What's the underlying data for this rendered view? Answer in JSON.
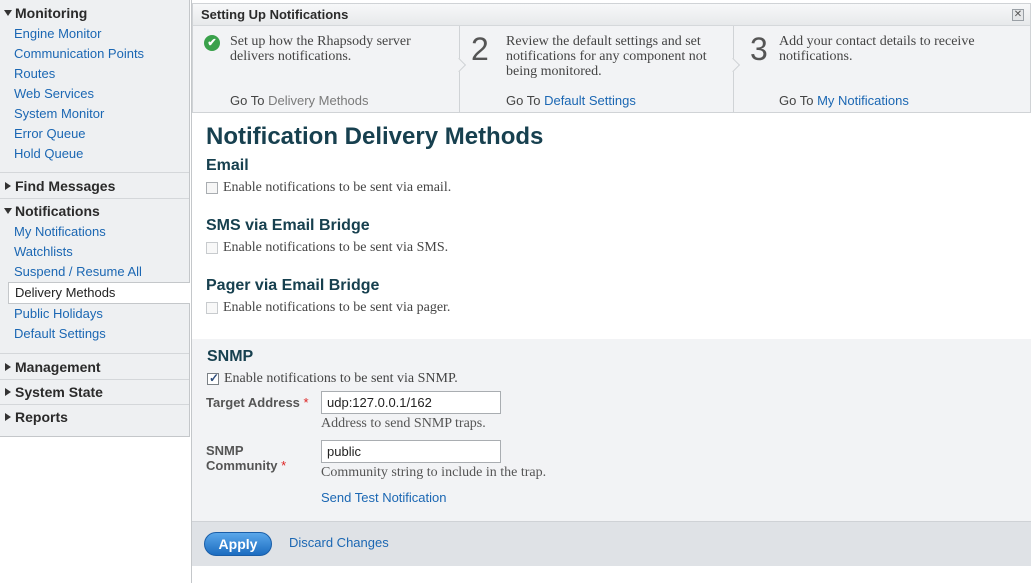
{
  "sidebar": {
    "monitoring": {
      "label": "Monitoring",
      "items": [
        "Engine Monitor",
        "Communication Points",
        "Routes",
        "Web Services",
        "System Monitor",
        "Error Queue",
        "Hold Queue"
      ]
    },
    "find_messages": "Find Messages",
    "notifications": {
      "label": "Notifications",
      "items": [
        "My Notifications",
        "Watchlists",
        "Suspend / Resume All",
        "Delivery Methods",
        "Public Holidays",
        "Default Settings"
      ],
      "active": "Delivery Methods"
    },
    "management": "Management",
    "system_state": "System State",
    "reports": "Reports"
  },
  "wizard": {
    "title": "Setting Up Notifications",
    "close_icon": "close-icon",
    "goto_prefix": "Go To",
    "steps": [
      {
        "marker": "✔",
        "text": "Set up how the Rhapsody server delivers notifications.",
        "link": "Delivery Methods",
        "status": "complete"
      },
      {
        "marker": "2",
        "text": "Review the default settings and set notifications for any component not being monitored.",
        "link": "Default Settings"
      },
      {
        "marker": "3",
        "text": "Add your contact details to receive notifications.",
        "link": "My Notifications"
      }
    ]
  },
  "main": {
    "title": "Notification Delivery Methods",
    "email": {
      "title": "Email",
      "checkbox_label": "Enable notifications to be sent via email.",
      "checked": false
    },
    "sms": {
      "title": "SMS via Email Bridge",
      "checkbox_label": "Enable notifications to be sent via SMS.",
      "checked": false
    },
    "pager": {
      "title": "Pager via Email Bridge",
      "checkbox_label": "Enable notifications to be sent via pager.",
      "checked": false
    },
    "snmp": {
      "title": "SNMP",
      "checkbox_label": "Enable notifications to be sent via SNMP.",
      "checked": true,
      "target_label": "Target Address",
      "target_value": "udp:127.0.0.1/162",
      "target_help": "Address to send SNMP traps.",
      "community_label_1": "SNMP",
      "community_label_2": "Community",
      "community_value": "public",
      "community_help": "Community string to include in the trap.",
      "required_mark": "*",
      "send_test": "Send Test Notification"
    }
  },
  "footer": {
    "apply": "Apply",
    "discard": "Discard Changes"
  },
  "colors": {
    "link": "#1b67b3",
    "heading": "#17404f",
    "check_green": "#3aa14b",
    "apply_blue": "#1c6cc0"
  }
}
